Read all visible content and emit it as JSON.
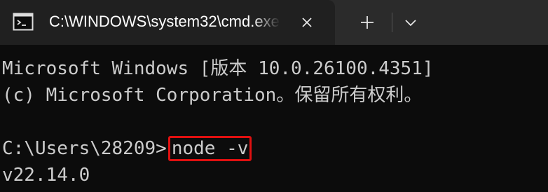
{
  "tab": {
    "title": "C:\\WINDOWS\\system32\\cmd.exe",
    "icon": "terminal-icon"
  },
  "toolbar": {
    "close_icon": "close-icon",
    "new_tab_icon": "plus-icon",
    "dropdown_icon": "chevron-down-icon"
  },
  "console": {
    "line1": "Microsoft Windows [版本 10.0.26100.4351]",
    "line2": "(c) Microsoft Corporation。保留所有权利。",
    "prompt": "C:\\Users\\28209>",
    "command": "node -v",
    "output": "v22.14.0"
  },
  "colors": {
    "background": "#0c0c0c",
    "text": "#cccccc",
    "highlight_border": "#e01010",
    "tab_active": "#202020",
    "tabstrip": "#2b2b2b"
  }
}
